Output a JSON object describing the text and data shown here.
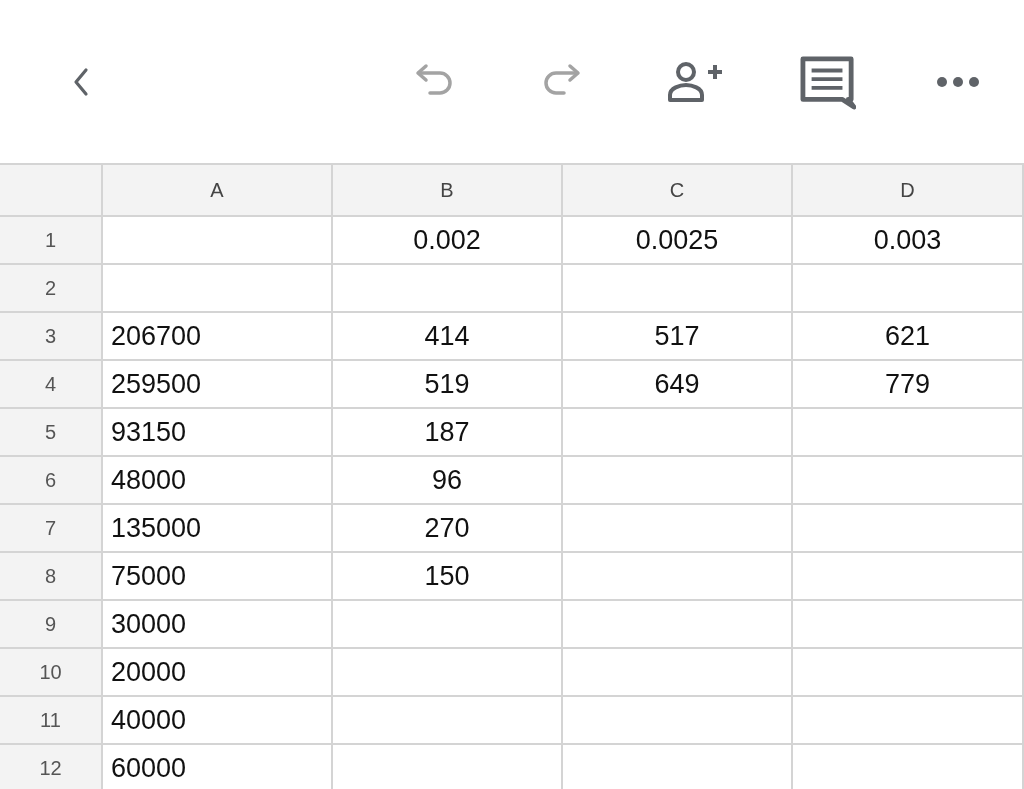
{
  "toolbar": {
    "back": {
      "kind": "back"
    },
    "actions": [
      {
        "kind": "undo",
        "disabled": true
      },
      {
        "kind": "redo",
        "disabled": true
      },
      {
        "kind": "add-person",
        "disabled": false
      },
      {
        "kind": "comment",
        "disabled": false
      },
      {
        "kind": "more",
        "disabled": false
      }
    ]
  },
  "sheet": {
    "columns": [
      {
        "label": "A"
      },
      {
        "label": "B"
      },
      {
        "label": "C"
      },
      {
        "label": "D"
      }
    ],
    "rows": [
      {
        "number": "1",
        "cells": [
          null,
          "0.002",
          "0.0025",
          "0.003"
        ]
      },
      {
        "number": "2",
        "cells": [
          null,
          null,
          null,
          null
        ]
      },
      {
        "number": "3",
        "cells": [
          "206700",
          "414",
          "517",
          "621"
        ]
      },
      {
        "number": "4",
        "cells": [
          "259500",
          "519",
          "649",
          "779"
        ]
      },
      {
        "number": "5",
        "cells": [
          "93150",
          "187",
          null,
          null
        ]
      },
      {
        "number": "6",
        "cells": [
          "48000",
          "96",
          null,
          null
        ]
      },
      {
        "number": "7",
        "cells": [
          "135000",
          "270",
          null,
          null
        ]
      },
      {
        "number": "8",
        "cells": [
          "75000",
          "150",
          null,
          null
        ]
      },
      {
        "number": "9",
        "cells": [
          "30000",
          null,
          null,
          null
        ]
      },
      {
        "number": "10",
        "cells": [
          "20000",
          null,
          null,
          null
        ]
      },
      {
        "number": "11",
        "cells": [
          "40000",
          null,
          null,
          null
        ]
      },
      {
        "number": "12",
        "cells": [
          "60000",
          null,
          null,
          null
        ]
      }
    ]
  }
}
